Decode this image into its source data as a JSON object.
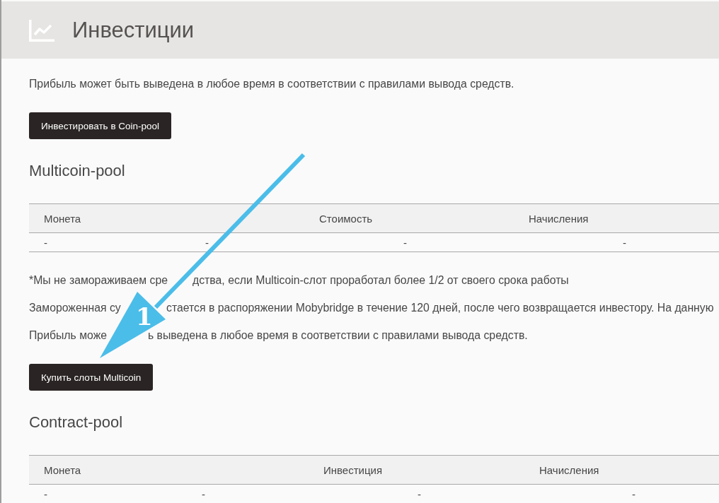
{
  "header": {
    "title": "Инвестиции"
  },
  "sections": [
    {
      "paragraphs": [
        {
          "parts": [
            "Прибыль может быть выведена в любое время в соответствии с правилами вывода средств."
          ]
        }
      ],
      "button": "Инвестировать в Coin-pool"
    },
    {
      "title": "Multicoin-pool",
      "table": {
        "columns": [
          "Монета",
          "Стоимость",
          "Начисления"
        ],
        "rows": [
          [
            "-",
            "-",
            "-",
            "-"
          ]
        ]
      },
      "paragraphs": [
        {
          "parts": [
            "*Мы не замораживаем сре",
            "дства, если Multicoin-слот проработал более 1/2 от своего срока работы"
          ]
        },
        {
          "parts": [
            "Замороженная су",
            "стается в распоряжении Mobybridge в течение 120 дней, после чего возвращается инвестору. На данную"
          ]
        },
        {
          "parts": [
            "Прибыль може",
            "ь выведена в любое время в соответствии с правилами вывода средств."
          ]
        }
      ],
      "button": "Купить слоты Multicoin"
    },
    {
      "title": "Contract-pool",
      "table": {
        "columns": [
          "Монета",
          "Инвестиция",
          "Начисления"
        ],
        "rows": [
          [
            "-",
            "-",
            "-",
            "-"
          ]
        ]
      }
    }
  ],
  "annotation": {
    "label": "1"
  }
}
